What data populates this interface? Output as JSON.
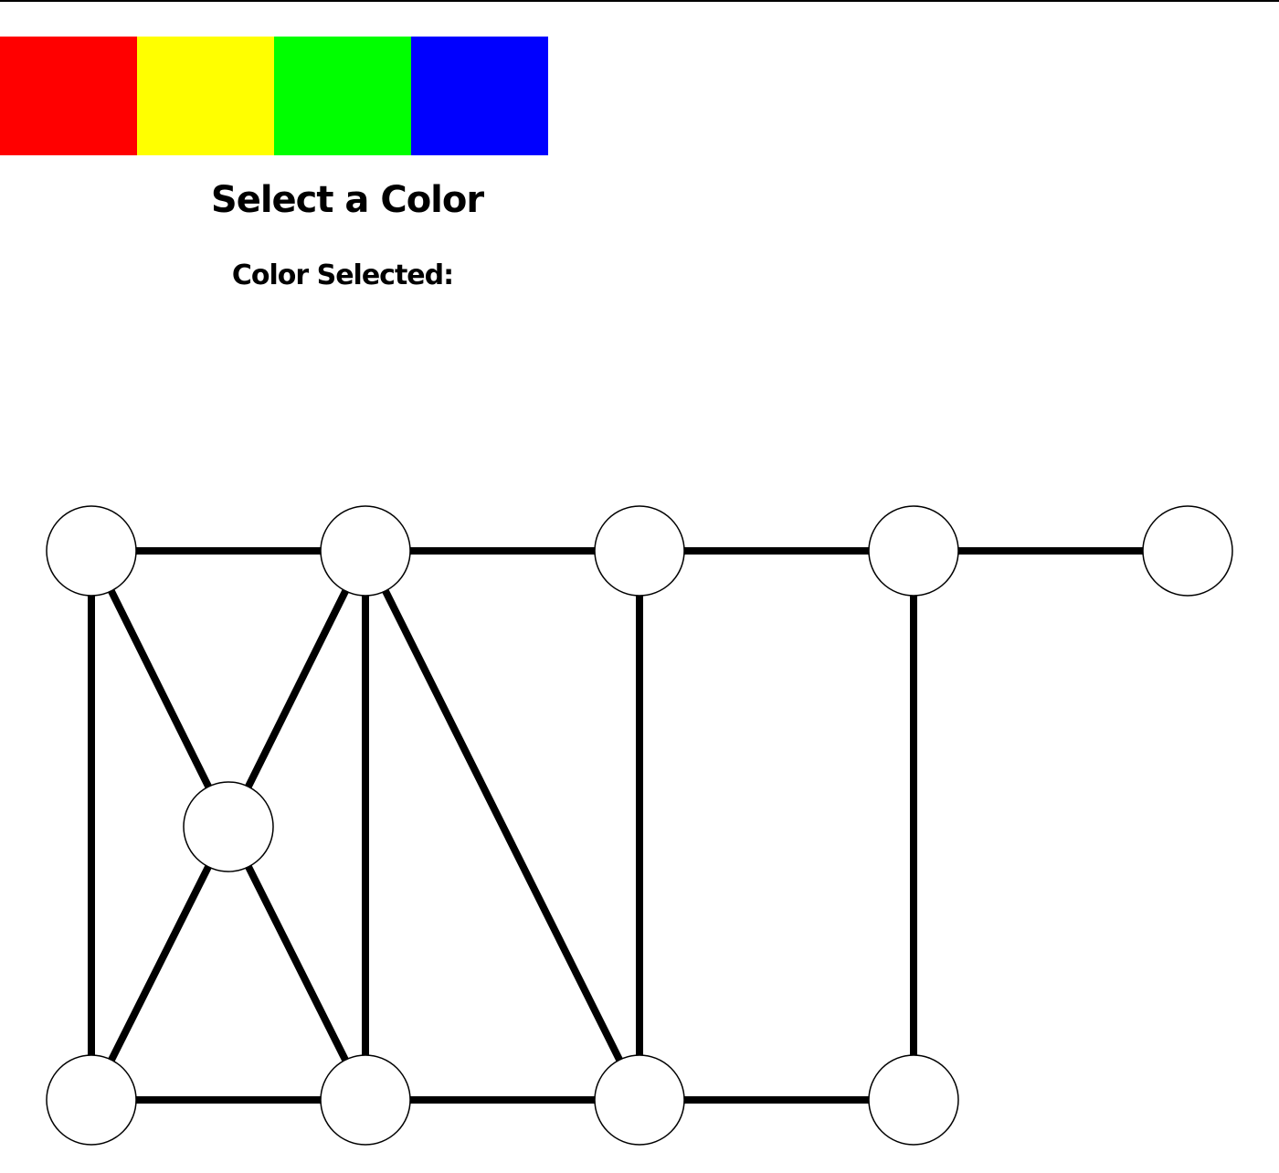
{
  "palette": {
    "colors": [
      {
        "name": "red",
        "hex": "#ff0000"
      },
      {
        "name": "yellow",
        "hex": "#ffff00"
      },
      {
        "name": "green",
        "hex": "#00ff00"
      },
      {
        "name": "blue",
        "hex": "#0000ff"
      }
    ]
  },
  "header": {
    "title": "Select a Color",
    "selected_label": "Color Selected:"
  },
  "graph": {
    "node_fill": "#ffffff",
    "stroke": "#000000",
    "nodes": [
      {
        "id": "a",
        "fill": "#ffffff"
      },
      {
        "id": "b",
        "fill": "#ffffff"
      },
      {
        "id": "c",
        "fill": "#ffffff"
      },
      {
        "id": "d",
        "fill": "#ffffff"
      },
      {
        "id": "e",
        "fill": "#ffffff"
      },
      {
        "id": "f",
        "fill": "#ffffff"
      },
      {
        "id": "g",
        "fill": "#ffffff"
      },
      {
        "id": "h",
        "fill": "#ffffff"
      },
      {
        "id": "i",
        "fill": "#ffffff"
      },
      {
        "id": "j",
        "fill": "#ffffff"
      }
    ],
    "edges": [
      [
        "a",
        "b"
      ],
      [
        "b",
        "c"
      ],
      [
        "c",
        "d"
      ],
      [
        "d",
        "e"
      ],
      [
        "a",
        "g"
      ],
      [
        "a",
        "f"
      ],
      [
        "b",
        "f"
      ],
      [
        "b",
        "h"
      ],
      [
        "b",
        "i"
      ],
      [
        "c",
        "i"
      ],
      [
        "d",
        "j"
      ],
      [
        "f",
        "g"
      ],
      [
        "f",
        "h"
      ],
      [
        "g",
        "h"
      ],
      [
        "h",
        "i"
      ],
      [
        "i",
        "j"
      ]
    ]
  }
}
